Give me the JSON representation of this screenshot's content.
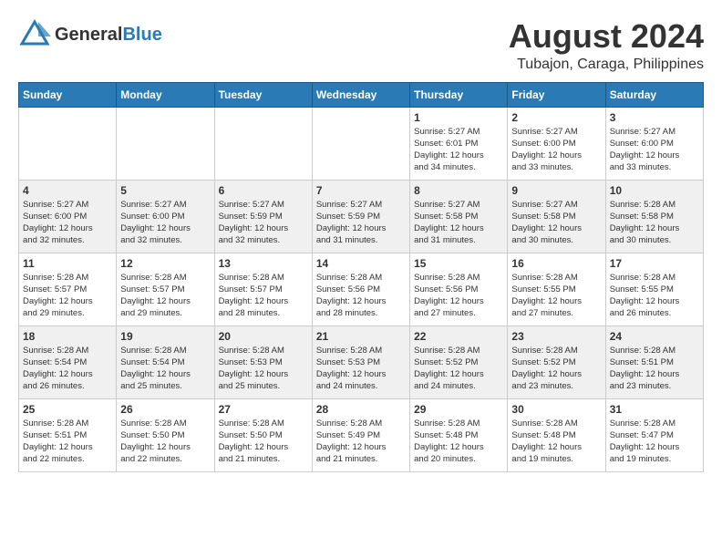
{
  "header": {
    "logo_general": "General",
    "logo_blue": "Blue",
    "month_year": "August 2024",
    "location": "Tubajon, Caraga, Philippines"
  },
  "days_of_week": [
    "Sunday",
    "Monday",
    "Tuesday",
    "Wednesday",
    "Thursday",
    "Friday",
    "Saturday"
  ],
  "weeks": [
    [
      {
        "day": "",
        "info": ""
      },
      {
        "day": "",
        "info": ""
      },
      {
        "day": "",
        "info": ""
      },
      {
        "day": "",
        "info": ""
      },
      {
        "day": "1",
        "info": "Sunrise: 5:27 AM\nSunset: 6:01 PM\nDaylight: 12 hours\nand 34 minutes."
      },
      {
        "day": "2",
        "info": "Sunrise: 5:27 AM\nSunset: 6:00 PM\nDaylight: 12 hours\nand 33 minutes."
      },
      {
        "day": "3",
        "info": "Sunrise: 5:27 AM\nSunset: 6:00 PM\nDaylight: 12 hours\nand 33 minutes."
      }
    ],
    [
      {
        "day": "4",
        "info": "Sunrise: 5:27 AM\nSunset: 6:00 PM\nDaylight: 12 hours\nand 32 minutes."
      },
      {
        "day": "5",
        "info": "Sunrise: 5:27 AM\nSunset: 6:00 PM\nDaylight: 12 hours\nand 32 minutes."
      },
      {
        "day": "6",
        "info": "Sunrise: 5:27 AM\nSunset: 5:59 PM\nDaylight: 12 hours\nand 32 minutes."
      },
      {
        "day": "7",
        "info": "Sunrise: 5:27 AM\nSunset: 5:59 PM\nDaylight: 12 hours\nand 31 minutes."
      },
      {
        "day": "8",
        "info": "Sunrise: 5:27 AM\nSunset: 5:58 PM\nDaylight: 12 hours\nand 31 minutes."
      },
      {
        "day": "9",
        "info": "Sunrise: 5:27 AM\nSunset: 5:58 PM\nDaylight: 12 hours\nand 30 minutes."
      },
      {
        "day": "10",
        "info": "Sunrise: 5:28 AM\nSunset: 5:58 PM\nDaylight: 12 hours\nand 30 minutes."
      }
    ],
    [
      {
        "day": "11",
        "info": "Sunrise: 5:28 AM\nSunset: 5:57 PM\nDaylight: 12 hours\nand 29 minutes."
      },
      {
        "day": "12",
        "info": "Sunrise: 5:28 AM\nSunset: 5:57 PM\nDaylight: 12 hours\nand 29 minutes."
      },
      {
        "day": "13",
        "info": "Sunrise: 5:28 AM\nSunset: 5:57 PM\nDaylight: 12 hours\nand 28 minutes."
      },
      {
        "day": "14",
        "info": "Sunrise: 5:28 AM\nSunset: 5:56 PM\nDaylight: 12 hours\nand 28 minutes."
      },
      {
        "day": "15",
        "info": "Sunrise: 5:28 AM\nSunset: 5:56 PM\nDaylight: 12 hours\nand 27 minutes."
      },
      {
        "day": "16",
        "info": "Sunrise: 5:28 AM\nSunset: 5:55 PM\nDaylight: 12 hours\nand 27 minutes."
      },
      {
        "day": "17",
        "info": "Sunrise: 5:28 AM\nSunset: 5:55 PM\nDaylight: 12 hours\nand 26 minutes."
      }
    ],
    [
      {
        "day": "18",
        "info": "Sunrise: 5:28 AM\nSunset: 5:54 PM\nDaylight: 12 hours\nand 26 minutes."
      },
      {
        "day": "19",
        "info": "Sunrise: 5:28 AM\nSunset: 5:54 PM\nDaylight: 12 hours\nand 25 minutes."
      },
      {
        "day": "20",
        "info": "Sunrise: 5:28 AM\nSunset: 5:53 PM\nDaylight: 12 hours\nand 25 minutes."
      },
      {
        "day": "21",
        "info": "Sunrise: 5:28 AM\nSunset: 5:53 PM\nDaylight: 12 hours\nand 24 minutes."
      },
      {
        "day": "22",
        "info": "Sunrise: 5:28 AM\nSunset: 5:52 PM\nDaylight: 12 hours\nand 24 minutes."
      },
      {
        "day": "23",
        "info": "Sunrise: 5:28 AM\nSunset: 5:52 PM\nDaylight: 12 hours\nand 23 minutes."
      },
      {
        "day": "24",
        "info": "Sunrise: 5:28 AM\nSunset: 5:51 PM\nDaylight: 12 hours\nand 23 minutes."
      }
    ],
    [
      {
        "day": "25",
        "info": "Sunrise: 5:28 AM\nSunset: 5:51 PM\nDaylight: 12 hours\nand 22 minutes."
      },
      {
        "day": "26",
        "info": "Sunrise: 5:28 AM\nSunset: 5:50 PM\nDaylight: 12 hours\nand 22 minutes."
      },
      {
        "day": "27",
        "info": "Sunrise: 5:28 AM\nSunset: 5:50 PM\nDaylight: 12 hours\nand 21 minutes."
      },
      {
        "day": "28",
        "info": "Sunrise: 5:28 AM\nSunset: 5:49 PM\nDaylight: 12 hours\nand 21 minutes."
      },
      {
        "day": "29",
        "info": "Sunrise: 5:28 AM\nSunset: 5:48 PM\nDaylight: 12 hours\nand 20 minutes."
      },
      {
        "day": "30",
        "info": "Sunrise: 5:28 AM\nSunset: 5:48 PM\nDaylight: 12 hours\nand 19 minutes."
      },
      {
        "day": "31",
        "info": "Sunrise: 5:28 AM\nSunset: 5:47 PM\nDaylight: 12 hours\nand 19 minutes."
      }
    ]
  ]
}
